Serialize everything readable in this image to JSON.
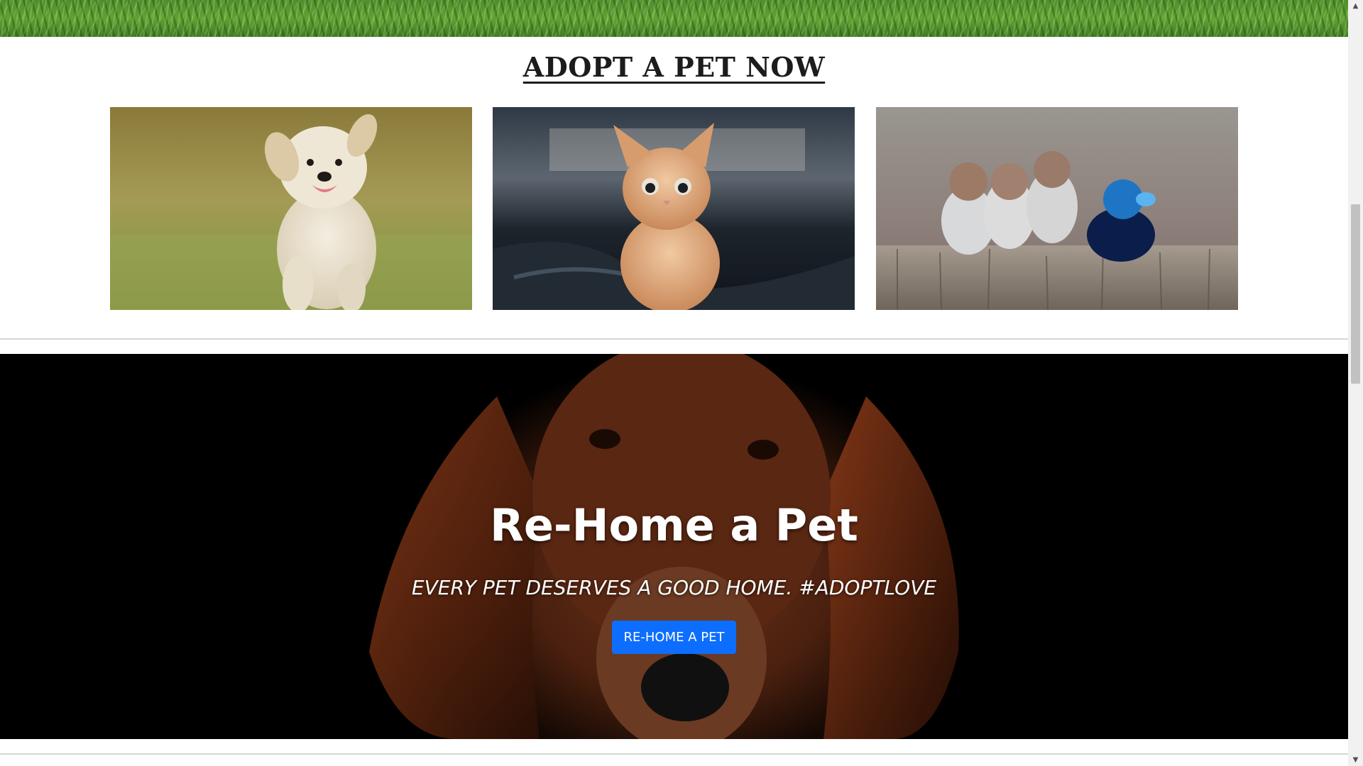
{
  "adopt_section": {
    "title": "ADOPT A PET NOW",
    "cards": [
      {
        "animal": "puppy"
      },
      {
        "animal": "kitten"
      },
      {
        "animal": "birds"
      }
    ]
  },
  "hero": {
    "title": "Re-Home a Pet",
    "subtitle": "EVERY PET DESERVES A GOOD HOME. #ADOPTLOVE",
    "button_label": "RE-HOME A PET",
    "button_color": "#0d6efd"
  },
  "scrollbar": {
    "up_icon": "▲",
    "down_icon": "▼"
  }
}
